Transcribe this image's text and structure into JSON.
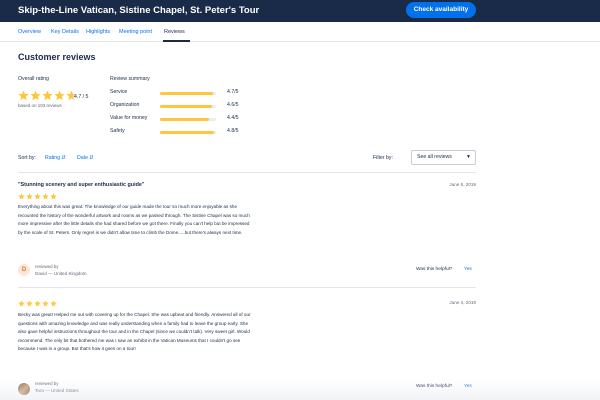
{
  "header": {
    "title": "Skip-the-Line Vatican, Sistine Chapel, St. Peter's Tour",
    "cta_label": "Check availability",
    "colors": {
      "bar": "#1a2b49",
      "cta": "#0071eb"
    }
  },
  "tabs": [
    {
      "label": "Overview",
      "active": false
    },
    {
      "label": "Key Details",
      "active": false
    },
    {
      "label": "Highlights",
      "active": false
    },
    {
      "label": "Meeting point",
      "active": false
    },
    {
      "label": "Reviews",
      "active": true
    }
  ],
  "reviews_section": {
    "title": "Customer reviews",
    "overall": {
      "label": "Overall rating",
      "score": "4.7 / 5",
      "rating": 4.7,
      "based_on": "based on 103 reviews"
    },
    "summary": {
      "label": "Review summary",
      "items": [
        {
          "label": "Service",
          "value": "4.7/5",
          "score": 4.7
        },
        {
          "label": "Organization",
          "value": "4.6/5",
          "score": 4.6
        },
        {
          "label": "Value for money",
          "value": "4.4/5",
          "score": 4.4
        },
        {
          "label": "Safety",
          "value": "4.8/5",
          "score": 4.8
        }
      ]
    },
    "star_color": "#ffc53d"
  },
  "sort": {
    "label": "Sort by:",
    "options": [
      {
        "label": "Rating",
        "icon": "sort-arrows-icon"
      },
      {
        "label": "Date",
        "icon": "sort-arrows-icon"
      }
    ]
  },
  "filter": {
    "label": "Filter by:",
    "selected": "See all reviews",
    "icon": "chevron-down-icon"
  },
  "reviews": [
    {
      "title": "\"Stunning scenery and super enthusiastic guide\"",
      "date": "June 5, 2019",
      "rating": 5,
      "body": "Everything about this was great. The knowledge of our guide made the tour so much more enjoyable as she recounted the history of the wonderful artwork and rooms as we passed through. The Sistine Chapel was so much more impressive after the little details she had shared before we got there. Finally you can't help but be impressed by the scale of St. Peters. Only regret is we didn't allow time to climb the Dome.....but there's always next time.",
      "reviewed_by": "reviewed by",
      "author": "David — United Kingdom",
      "avatar_letter": "D",
      "helpful_label": "Was this helpful?",
      "yes_label": "Yes"
    },
    {
      "title": "",
      "date": "June 4, 2019",
      "rating": 5,
      "body": "Becky was great! Helped me out with covering up for the Chapel. She was upbeat and friendly. Answered all of our questions with amazing knowledge and was really understanding when a family had to leave the group early. She also gave helpful instructions throughout the tour and in the Chapel (since we couldn't talk). Very sweet girl. Would recommend. The only bit that bothered me was I saw an exhibit in the Vatican Museums that I couldn't go see because I was in a group. But that's how it goes on a tour!",
      "reviewed_by": "reviewed by",
      "author": "Tara — United States",
      "avatar_letter": "",
      "helpful_label": "Was this helpful?",
      "yes_label": "Yes"
    }
  ]
}
